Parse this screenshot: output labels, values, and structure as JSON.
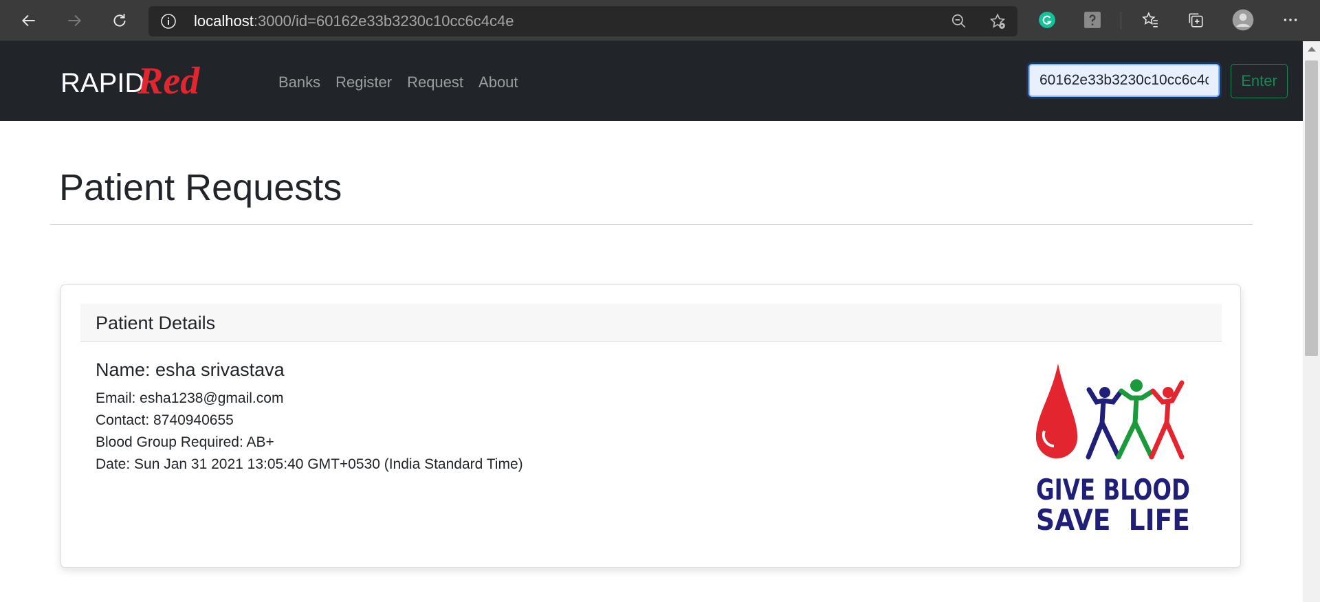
{
  "browser": {
    "url_host": "localhost",
    "url_path": ":3000/id=60162e33b3230c10cc6c4c4e"
  },
  "navbar": {
    "brand_part1": "RAPID",
    "brand_part2": "Red",
    "links": [
      "Banks",
      "Register",
      "Request",
      "About"
    ],
    "search_value": "60162e33b3230c10cc6c4c4e",
    "enter_label": "Enter"
  },
  "page": {
    "title": "Patient Requests"
  },
  "card": {
    "header": "Patient Details",
    "name_line": "Name: esha srivastava",
    "email_line": "Email: esha1238@gmail.com",
    "contact_line": "Contact: 8740940655",
    "blood_group_line": "Blood Group Required: AB+",
    "date_line": "Date: Sun Jan 31 2021 13:05:40 GMT+0530 (India Standard Time)",
    "logo_line1": "GIVE BLOOD",
    "logo_line2": "SAVE  LIFE"
  },
  "colors": {
    "navbar_bg": "#212529",
    "brand_red": "#e32530",
    "enter_green": "#198754",
    "logo_navy": "#1f1f7a",
    "logo_green": "#1a9a3a"
  }
}
